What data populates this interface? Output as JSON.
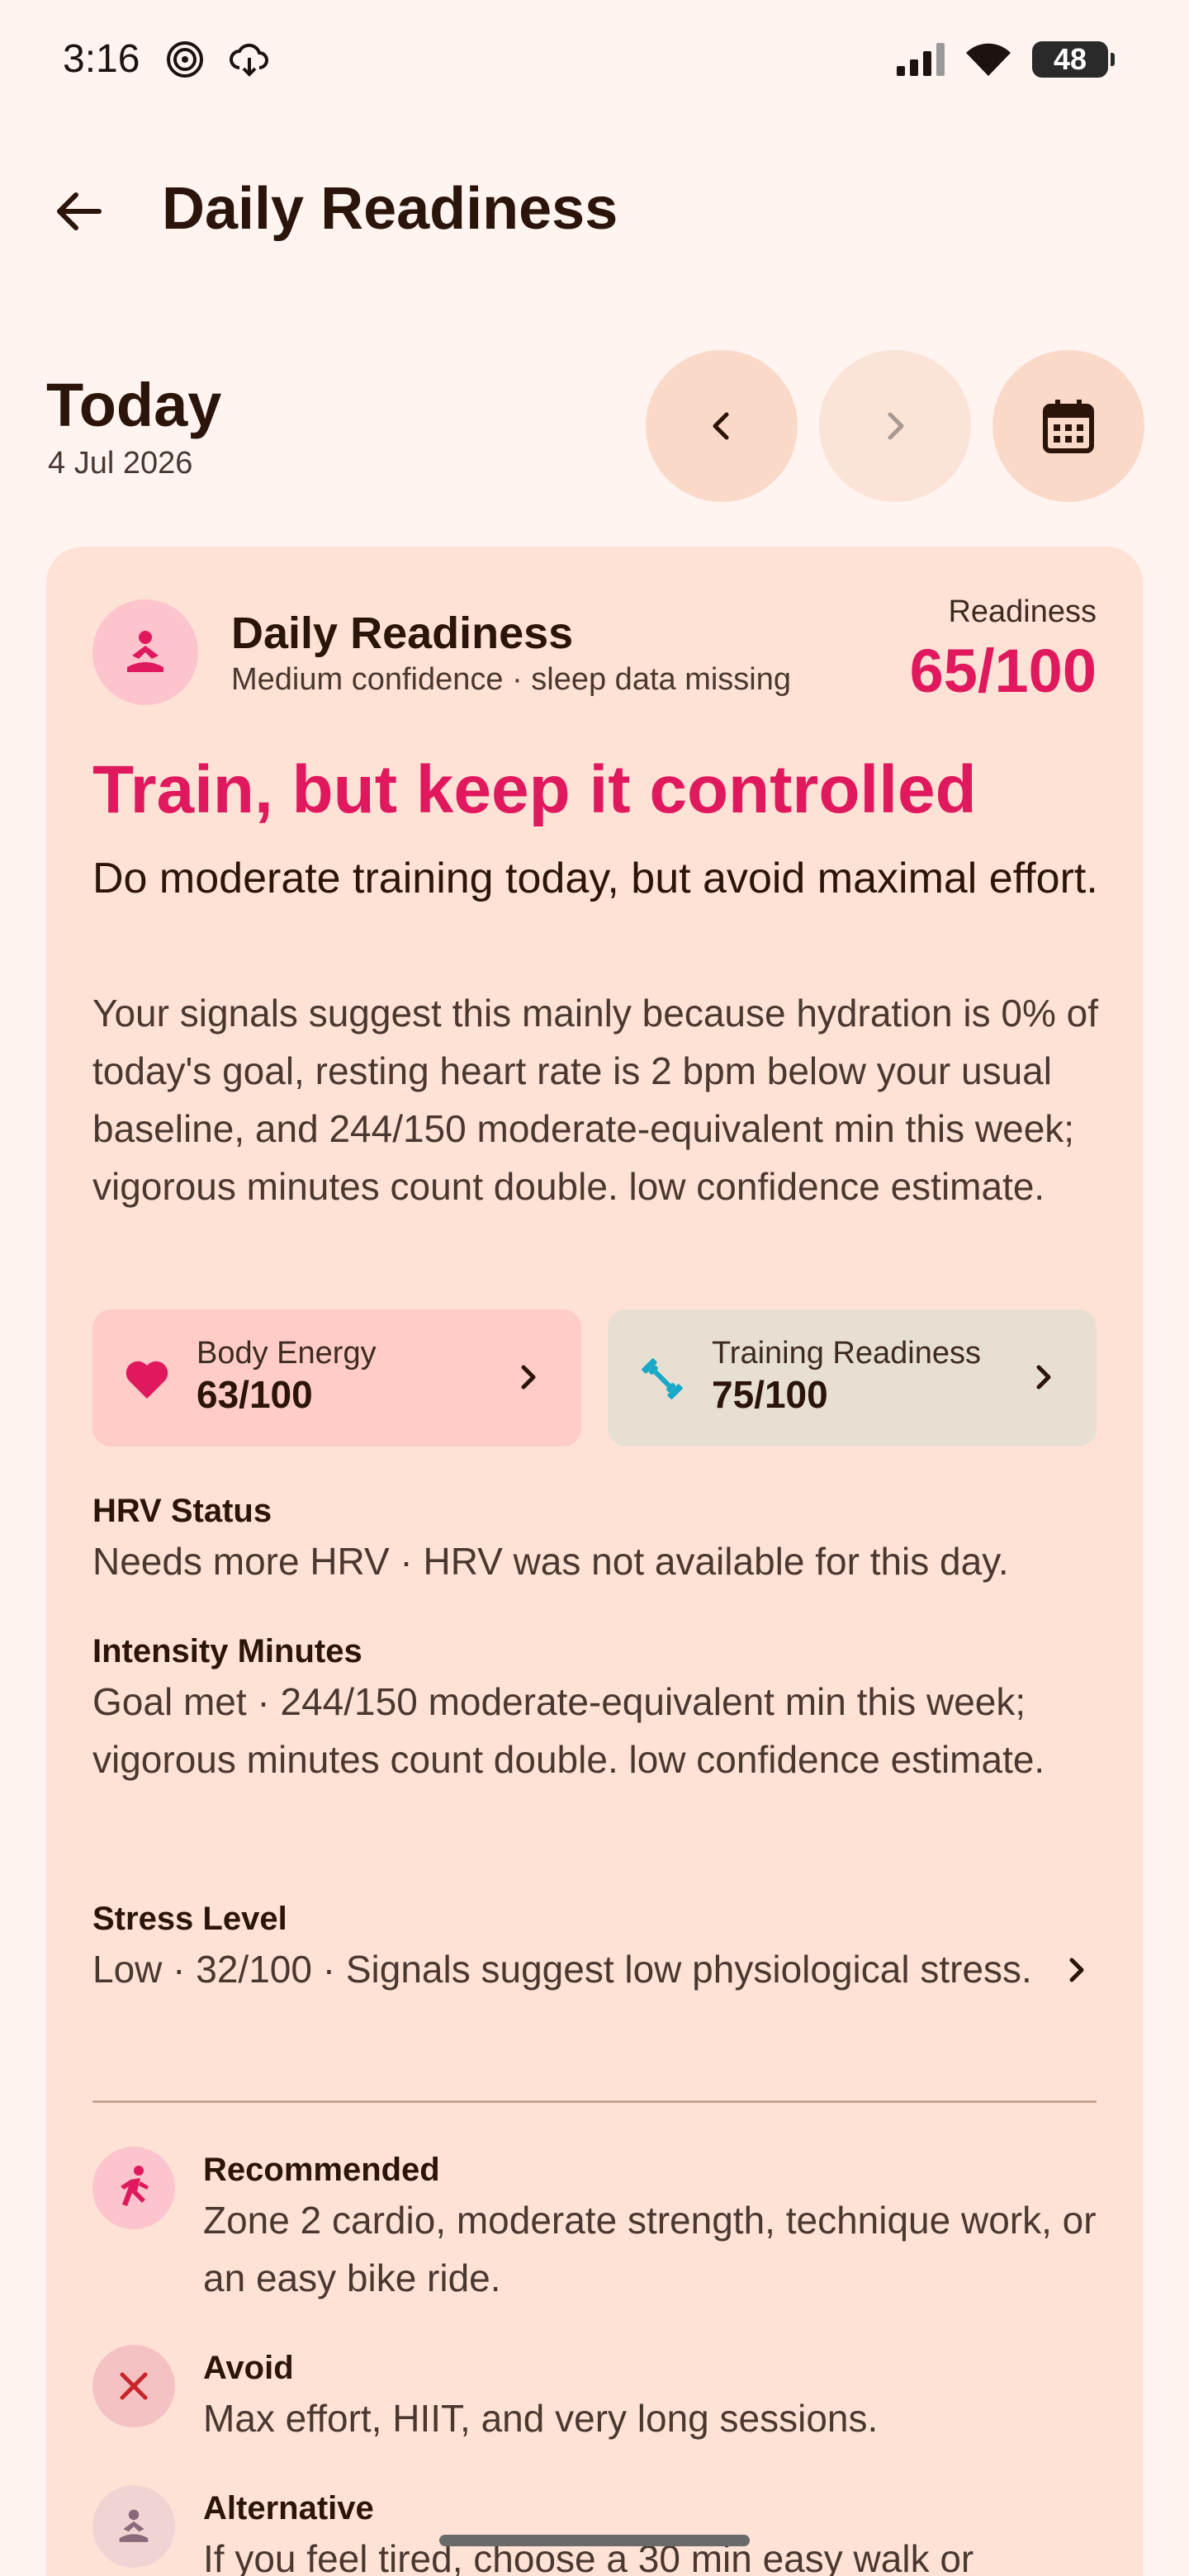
{
  "status_bar": {
    "time": "3:16",
    "battery": "48"
  },
  "app_bar": {
    "title": "Daily Readiness"
  },
  "date_nav": {
    "label": "Today",
    "date": "4 Jul 2026"
  },
  "card": {
    "title": "Daily Readiness",
    "subtitle": "Medium confidence · sleep data missing",
    "readiness_label": "Readiness",
    "readiness_value": "65/100",
    "headline": "Train, but keep it controlled",
    "lead": "Do moderate training today, but avoid maximal effort.",
    "explanation": "Your signals suggest this mainly because hydration is 0% of today's goal, resting heart rate is 2 bpm below your usual baseline, and 244/150 moderate-equivalent min this week; vigorous minutes count double. low confidence estimate.",
    "chips": [
      {
        "label": "Body Energy",
        "value": "63/100"
      },
      {
        "label": "Training Readiness",
        "value": "75/100"
      }
    ],
    "sections": [
      {
        "label": "HRV Status",
        "text": "Needs more HRV · HRV was not available for this day."
      },
      {
        "label": "Intensity Minutes",
        "text": "Goal met · 244/150 moderate-equivalent min this week; vigorous minutes count double. low confidence estimate."
      },
      {
        "label": "Stress Level",
        "text": "Low · 32/100 · Signals suggest low physiological stress."
      }
    ],
    "recommendations": [
      {
        "label": "Recommended",
        "text": "Zone 2 cardio, moderate strength, technique work, or an easy bike ride."
      },
      {
        "label": "Avoid",
        "text": "Max effort, HIIT, and very long sessions."
      },
      {
        "label": "Alternative",
        "text": "If you feel tired, choose a 30 min easy walk or"
      }
    ]
  },
  "colors": {
    "accent": "#e0185e",
    "background": "#fff4f0",
    "card": "#ffe2d6"
  }
}
